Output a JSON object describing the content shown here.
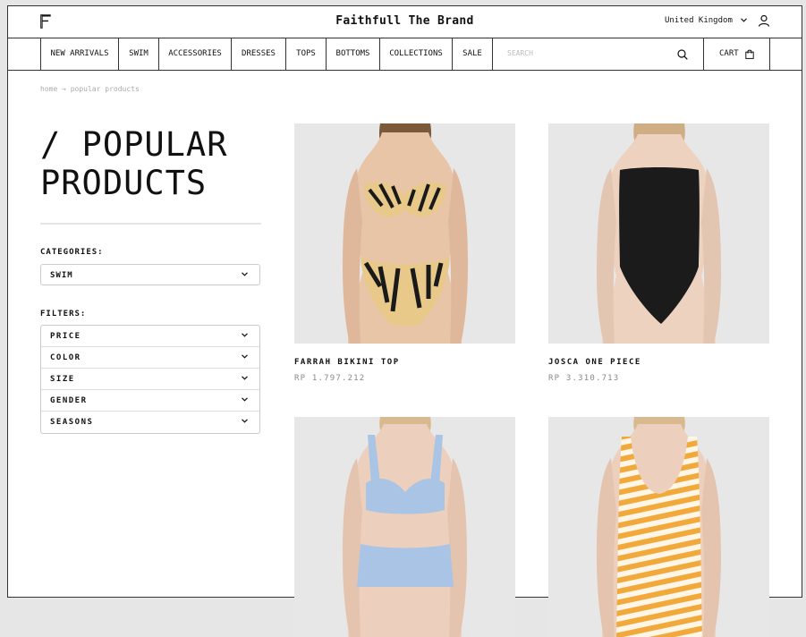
{
  "header": {
    "brand": "Faithfull The Brand",
    "country": "United Kingdom"
  },
  "nav": {
    "items": [
      "NEW ARRIVALS",
      "SWIM",
      "ACCESSORIES",
      "DRESSES",
      "TOPS",
      "BOTTOMS",
      "COLLECTIONS",
      "SALE"
    ],
    "search_placeholder": "SEARCH",
    "cart_label": "CART"
  },
  "breadcrumb": "home → popular products",
  "page_title": "/ POPULAR\nPRODUCTS",
  "categories": {
    "label": "CATEGORIES:",
    "selected": "SWIM"
  },
  "filters": {
    "label": "FILTERS:",
    "items": [
      "PRICE",
      "COLOR",
      "SIZE",
      "GENDER",
      "SEASONS"
    ]
  },
  "products": [
    {
      "name": "FARRAH BIKINI TOP",
      "price": "RP 1.797.212",
      "style": "zebra-bikini",
      "colors": [
        "#e8c98a",
        "#1a1a1a"
      ]
    },
    {
      "name": "JOSCA ONE PIECE",
      "price": "RP 3.310.713",
      "style": "black-onepiece",
      "colors": [
        "#1b1b1b"
      ]
    },
    {
      "name": "",
      "price": "",
      "style": "blue-bikini",
      "colors": [
        "#a9c4e4"
      ]
    },
    {
      "name": "",
      "price": "",
      "style": "yellow-striped-onepiece",
      "colors": [
        "#f2a93b",
        "#ffffff"
      ]
    }
  ],
  "icons": {
    "logo": "brand-logo-f",
    "country_chevron": "chevron-down-icon",
    "user": "user-icon",
    "search": "search-icon",
    "cart": "shopping-bag-icon",
    "select_chevron": "chevron-down-icon"
  }
}
